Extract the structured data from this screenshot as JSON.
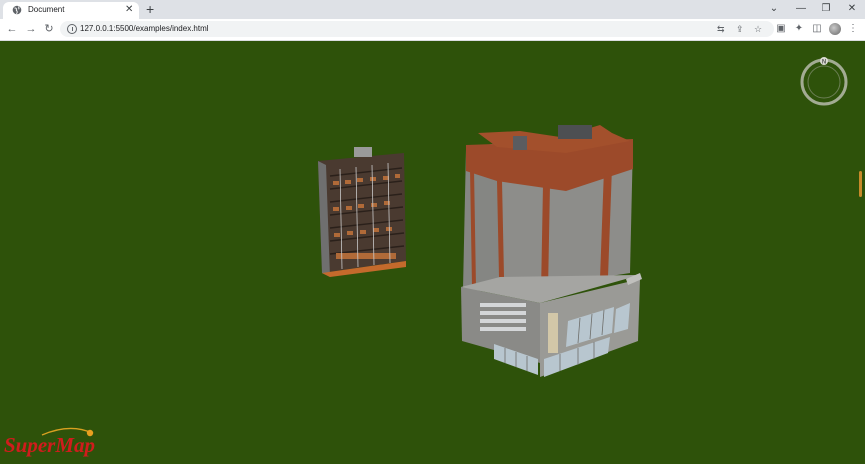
{
  "browser": {
    "tab_title": "Document",
    "tab_close": "✕",
    "new_tab": "+",
    "url": "127.0.0.1:5500/examples/index.html",
    "window_controls": {
      "dropdown": "⌄",
      "minimize": "—",
      "restore": "❐",
      "close": "✕"
    },
    "nav": {
      "back": "←",
      "forward": "→",
      "reload": "↻"
    },
    "omnibox_icons": {
      "translate": "⇆",
      "share": "⇪",
      "bookmark": "☆"
    },
    "toolbar_icons": {
      "extension_app": "▣",
      "extensions": "✦",
      "sidepanel": "◫",
      "menu": "⋮"
    }
  },
  "viewer": {
    "compass_label": "N",
    "logo_text": "SuperMap",
    "colors": {
      "ground": "#2e520a",
      "brick": "#9c4a2a",
      "concrete": "#8d8d8a",
      "glass": "#b8c6cf",
      "logo": "#d01c1c"
    }
  }
}
